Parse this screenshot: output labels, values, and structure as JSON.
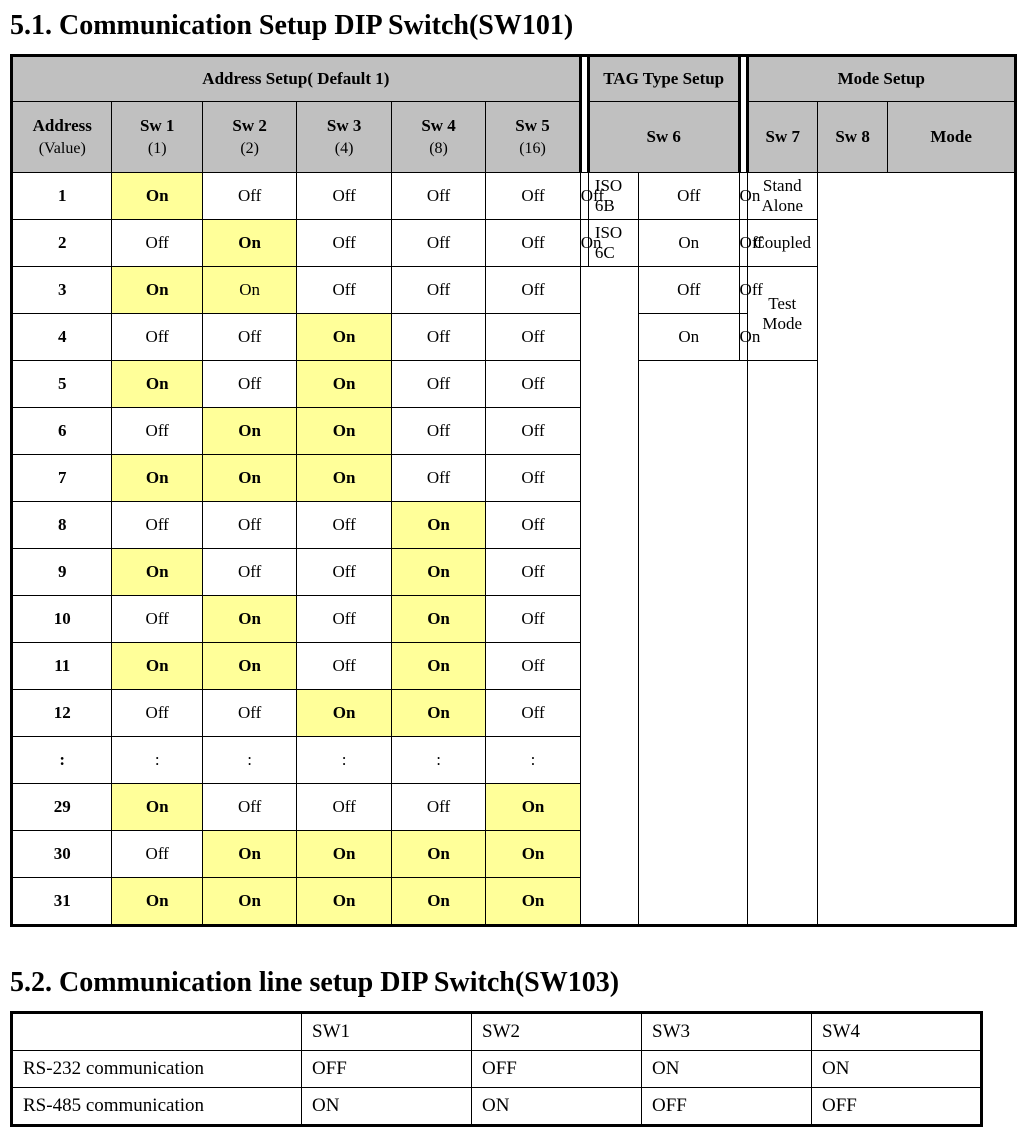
{
  "section1": {
    "heading": "5.1. Communication Setup DIP Switch(SW101)",
    "groupHeaders": {
      "address": "Address Setup( Default 1)",
      "tag": "TAG Type Setup",
      "mode": "Mode Setup"
    },
    "colHeaders": {
      "addr": {
        "l1": "Address",
        "l2": "(Value)"
      },
      "sw1": {
        "l1": "Sw 1",
        "l2": "(1)"
      },
      "sw2": {
        "l1": "Sw 2",
        "l2": "(2)"
      },
      "sw3": {
        "l1": "Sw 3",
        "l2": "(4)"
      },
      "sw4": {
        "l1": "Sw  4",
        "l2": "(8)"
      },
      "sw5": {
        "l1": "Sw 5",
        "l2": "(16)"
      },
      "sw6": "Sw 6",
      "sw7": "Sw 7",
      "sw8": "Sw 8",
      "mode": "Mode"
    },
    "rows": [
      {
        "addr": "1",
        "sw": [
          "On",
          "Off",
          "Off",
          "Off",
          "Off"
        ],
        "on": [
          1,
          0,
          0,
          0,
          0
        ]
      },
      {
        "addr": "2",
        "sw": [
          "Off",
          "On",
          "Off",
          "Off",
          "Off"
        ],
        "on": [
          0,
          1,
          0,
          0,
          0
        ]
      },
      {
        "addr": "3",
        "sw": [
          "On",
          "On",
          "Off",
          "Off",
          "Off"
        ],
        "on": [
          1,
          2,
          0,
          0,
          0
        ]
      },
      {
        "addr": "4",
        "sw": [
          "Off",
          "Off",
          "On",
          "Off",
          "Off"
        ],
        "on": [
          0,
          0,
          1,
          0,
          0
        ]
      },
      {
        "addr": "5",
        "sw": [
          "On",
          "Off",
          "On",
          "Off",
          "Off"
        ],
        "on": [
          1,
          0,
          1,
          0,
          0
        ]
      },
      {
        "addr": "6",
        "sw": [
          "Off",
          "On",
          "On",
          "Off",
          "Off"
        ],
        "on": [
          0,
          1,
          1,
          0,
          0
        ]
      },
      {
        "addr": "7",
        "sw": [
          "On",
          "On",
          "On",
          "Off",
          "Off"
        ],
        "on": [
          1,
          1,
          1,
          0,
          0
        ]
      },
      {
        "addr": "8",
        "sw": [
          "Off",
          "Off",
          "Off",
          "On",
          "Off"
        ],
        "on": [
          0,
          0,
          0,
          1,
          0
        ]
      },
      {
        "addr": "9",
        "sw": [
          "On",
          "Off",
          "Off",
          "On",
          "Off"
        ],
        "on": [
          1,
          0,
          0,
          1,
          0
        ]
      },
      {
        "addr": "10",
        "sw": [
          "Off",
          "On",
          "Off",
          "On",
          "Off"
        ],
        "on": [
          0,
          1,
          0,
          1,
          0
        ]
      },
      {
        "addr": "11",
        "sw": [
          "On",
          "On",
          "Off",
          "On",
          "Off"
        ],
        "on": [
          1,
          1,
          0,
          1,
          0
        ]
      },
      {
        "addr": "12",
        "sw": [
          "Off",
          "Off",
          "On",
          "On",
          "Off"
        ],
        "on": [
          0,
          0,
          1,
          1,
          0
        ]
      },
      {
        "addr": ":",
        "sw": [
          ":",
          ":",
          ":",
          ":",
          ":"
        ],
        "on": [
          0,
          0,
          0,
          0,
          0
        ]
      },
      {
        "addr": "29",
        "sw": [
          "On",
          "Off",
          "Off",
          "Off",
          "On"
        ],
        "on": [
          1,
          0,
          0,
          0,
          1
        ]
      },
      {
        "addr": "30",
        "sw": [
          "Off",
          "On",
          "On",
          "On",
          "On"
        ],
        "on": [
          0,
          1,
          1,
          1,
          1
        ]
      },
      {
        "addr": "31",
        "sw": [
          "On",
          "On",
          "On",
          "On",
          "On"
        ],
        "on": [
          1,
          1,
          1,
          1,
          1
        ]
      }
    ],
    "tag": {
      "r1": {
        "sw6": "Off",
        "label": "ISO 6B"
      },
      "r2": {
        "sw6": "On",
        "label": "ISO 6C"
      }
    },
    "mode": {
      "r1": {
        "sw7": "Off",
        "sw8": "On",
        "mode": "Stand Alone"
      },
      "r2": {
        "sw7": "On",
        "sw8": "Off",
        "mode": "Coupled"
      },
      "r3": {
        "sw7": "Off",
        "sw8": "Off"
      },
      "r4": {
        "sw7": "On",
        "sw8": "On"
      },
      "testmode": "Test Mode"
    }
  },
  "section2": {
    "heading": "5.2. Communication line setup DIP Switch(SW103)",
    "headers": [
      "",
      "SW1",
      "SW2",
      "SW3",
      "SW4"
    ],
    "rows": [
      {
        "label": "RS-232 communication",
        "v": [
          "OFF",
          "OFF",
          "ON",
          "ON"
        ]
      },
      {
        "label": "RS-485 communication",
        "v": [
          "ON",
          "ON",
          "OFF",
          "OFF"
        ]
      }
    ]
  }
}
